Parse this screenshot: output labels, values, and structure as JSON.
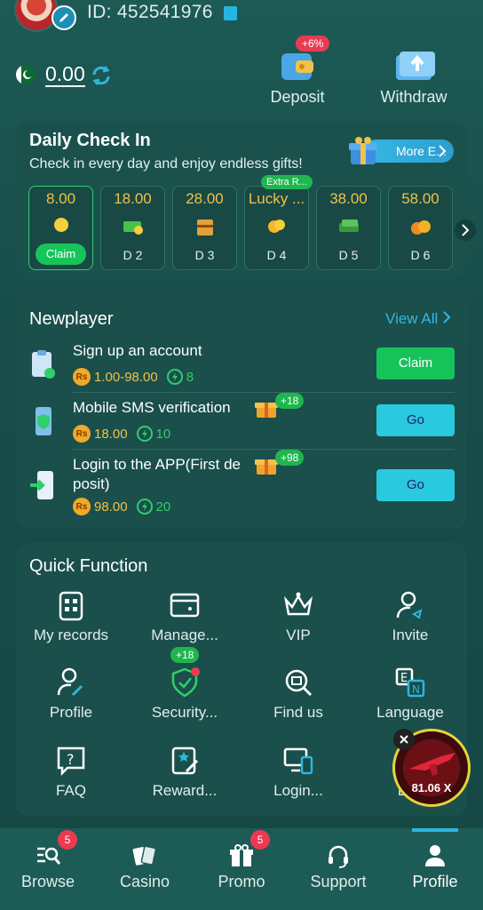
{
  "header": {
    "id_label": "ID: 452541976",
    "balance": "0.00",
    "deposit_label": "Deposit",
    "deposit_badge": "+6%",
    "withdraw_label": "Withdraw"
  },
  "checkin": {
    "title": "Daily Check In",
    "subtitle": "Check in every day and enjoy endless gifts!",
    "more_label": "More E...",
    "days": [
      {
        "amount": "8.00",
        "label": "Claim",
        "active": true
      },
      {
        "amount": "18.00",
        "label": "D 2"
      },
      {
        "amount": "28.00",
        "label": "D 3"
      },
      {
        "amount": "Lucky ...",
        "label": "D 4",
        "tag": "Extra R..."
      },
      {
        "amount": "38.00",
        "label": "D 5"
      },
      {
        "amount": "58.00",
        "label": "D 6"
      }
    ]
  },
  "newplayer": {
    "title": "Newplayer",
    "view_all": "View All",
    "tasks": [
      {
        "title": "Sign up an account",
        "reward_cash": "1.00-98.00",
        "reward_points": "8",
        "button": "Claim"
      },
      {
        "title": "Mobile SMS verification",
        "reward_cash": "18.00",
        "reward_points": "10",
        "button": "Go",
        "bonus": "+18"
      },
      {
        "title_line1": "Login to the APP(First de",
        "title_line2": "posit)",
        "reward_cash": "98.00",
        "reward_points": "20",
        "button": "Go",
        "bonus": "+98"
      }
    ],
    "currency_symbol": "Rs"
  },
  "quick": {
    "title": "Quick Function",
    "items": [
      {
        "label": "My records",
        "icon": "records-icon"
      },
      {
        "label": "Manage...",
        "icon": "card-icon"
      },
      {
        "label": "VIP",
        "icon": "crown-icon"
      },
      {
        "label": "Invite",
        "icon": "invite-icon"
      },
      {
        "label": "Profile",
        "icon": "profile-icon"
      },
      {
        "label": "Security...",
        "icon": "shield-icon",
        "bonus": "+18"
      },
      {
        "label": "Find us",
        "icon": "find-icon"
      },
      {
        "label": "Language",
        "icon": "language-icon"
      },
      {
        "label": "FAQ",
        "icon": "faq-icon"
      },
      {
        "label": "Reward...",
        "icon": "reward-icon"
      },
      {
        "label": "Login...",
        "icon": "devices-icon"
      },
      {
        "label": "Log",
        "icon": "logout-icon"
      }
    ]
  },
  "game_widget": {
    "multiplier": "81.06 X"
  },
  "nav": {
    "items": [
      {
        "label": "Browse",
        "badge": "5"
      },
      {
        "label": "Casino"
      },
      {
        "label": "Promo",
        "badge": "5"
      },
      {
        "label": "Support"
      },
      {
        "label": "Profile",
        "active": true
      }
    ]
  },
  "colors": {
    "accent": "#2fb6dc",
    "green": "#16c35a",
    "gold": "#f2c14b",
    "badge_red": "#ea3a52"
  }
}
